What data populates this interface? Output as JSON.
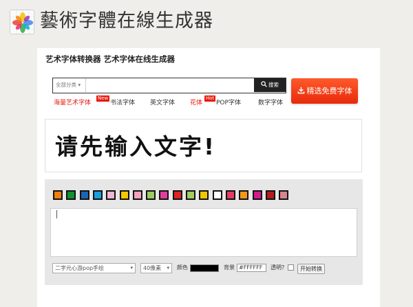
{
  "header": {
    "title": "藝術字體在線生成器"
  },
  "main": {
    "subtitle": "艺术字体转换器 艺术字体在线生成器"
  },
  "search": {
    "category": "全部分类",
    "button": "搜索",
    "placeholder": ""
  },
  "cta": {
    "label": "精选免费字体"
  },
  "nav": [
    {
      "label": "海量艺术字体",
      "badge": "New"
    },
    {
      "label": "书法字体"
    },
    {
      "label": "英文字体"
    },
    {
      "label": "花体",
      "badge": "Hot"
    },
    {
      "label": "POP字体"
    },
    {
      "label": "数字字体"
    }
  ],
  "preview": {
    "text": "请先输入文字!"
  },
  "swatches": [
    "#f07f0c",
    "#0f9130",
    "#1f64b0",
    "#19a0dc",
    "#eeb7d2",
    "#f5c800",
    "#f4a3bd",
    "#9ccc60",
    "#e13d9a",
    "#dd2323",
    "#a0cf60",
    "#f2c600",
    "#ffffff",
    "#e23c63",
    "#f59818",
    "#d21b8a",
    "#b51d1d",
    "#d4858e"
  ],
  "controls": {
    "font_select": "二字元心游pop手绘",
    "size_select": "40像素",
    "color_label": "颜色",
    "bg_label": "背景",
    "bg_value": "#FFFFFF",
    "transparent_label": "透明?",
    "start_button": "开始转换"
  }
}
